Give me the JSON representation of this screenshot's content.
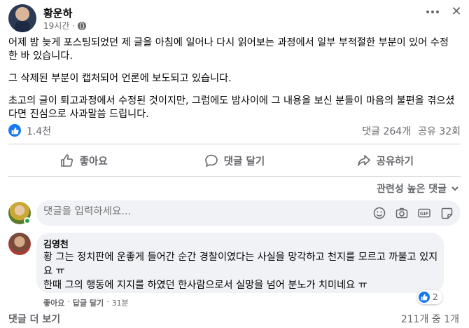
{
  "post": {
    "author": "황운하",
    "time": "19시간",
    "paragraphs": [
      "어제 밤 늦게 포스팅되었던 제 글을 아침에 일어나 다시 읽어보는 과정에서 일부 부적절한 부분이 있어 수정한 바 있습니다.",
      "그 삭제된 부분이 캡처되어 언론에 보도되고 있습니다.",
      "초고의 글이 퇴고과정에서 수정된 것이지만, 그럼에도 밤사이에 그 내용을 보신 분들이 마음의 불편을 겪으셨다면 진심으로 사과말씀 드립니다."
    ],
    "reaction_count": "1.4천",
    "comment_count": "댓글 264개",
    "share_count": "공유 32회"
  },
  "actions": {
    "like": "좋아요",
    "comment": "댓글 달기",
    "share": "공유하기"
  },
  "sort_label": "관련성 높은 댓글",
  "composer": {
    "placeholder": "댓글을 입력하세요..."
  },
  "comment": {
    "author": "김영천",
    "text_line1": "황 그는 정치판에 운좋게 들어간 순간 경찰이였다는 사실을 망각하고 천지를 모르고 까불고 있지요 ㅠ",
    "text_line2": "한때 그의 행동에 지지를 하였던 한사람으로서 실망을 넘어 분노가 치미네요 ㅠ",
    "like_label": "좋아요",
    "reply_label": "답글 달기",
    "time": "31분",
    "separator": "·",
    "reaction_count": "2"
  },
  "footer": {
    "more_comments": "댓글 더 보기",
    "pager": "211개 중 1개"
  },
  "colors": {
    "accent": "#1877f2",
    "muted": "#65676b",
    "bubble": "#f0f2f5",
    "online": "#31a24c"
  },
  "icons": [
    "globe-icon",
    "more-icon",
    "close-icon",
    "like-icon",
    "comment-icon",
    "share-icon",
    "chevron-down-icon",
    "emoji-icon",
    "camera-icon",
    "gif-icon",
    "sticker-icon"
  ]
}
